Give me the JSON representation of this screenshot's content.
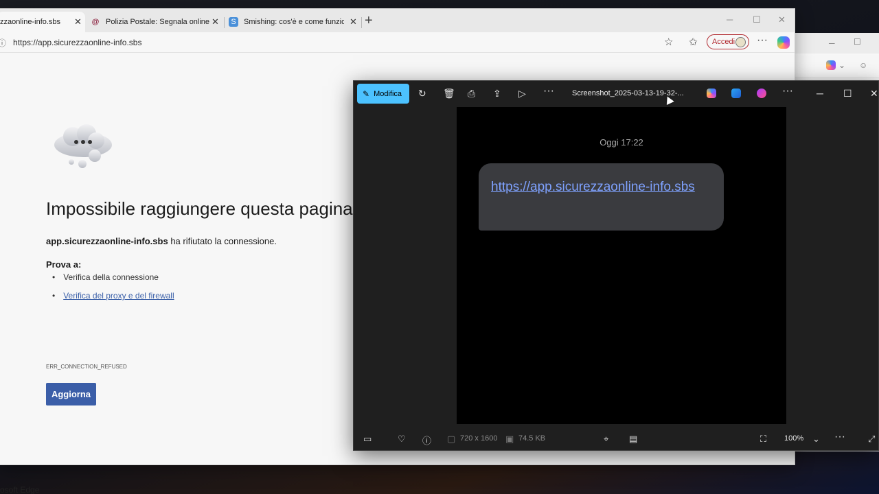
{
  "edge": {
    "tabs": [
      {
        "title": "zzaonline-info.sbs",
        "favicon": "page-icon"
      },
      {
        "title": "Polizia Postale: Segnala online",
        "favicon": "at-sign-icon"
      },
      {
        "title": "Smishing: cos'è e come funziona",
        "favicon": "page-icon"
      }
    ],
    "url": "https://app.sicurezzaonline-info.sbs",
    "signin_label": "Accedi",
    "error": {
      "title": "Impossibile raggiungere questa pagina",
      "host": "app.sicurezzaonline-info.sbs",
      "message": "ha rifiutato la connessione.",
      "try_label": "Prova a:",
      "suggestions": [
        "Verifica della connessione",
        "Verifica del proxy e del firewall"
      ],
      "code": "ERR_CONNECTION_REFUSED",
      "reload_label": "Aggiorna"
    },
    "brand_footer": "osoft Edge"
  },
  "photos": {
    "edit_label": "Modifica",
    "filename": "Screenshot_2025-03-13-19-32-...",
    "sms": {
      "time": "Oggi 17:22",
      "link": "https://app.sicurezzaonline-info.sbs"
    },
    "dimensions": "720 x 1600",
    "filesize": "74.5 KB",
    "zoom": "100%"
  },
  "colors": {
    "accent_edit": "#4cc2ff",
    "reload_button": "#3b5ea8",
    "sms_link": "#7fa2ff"
  }
}
